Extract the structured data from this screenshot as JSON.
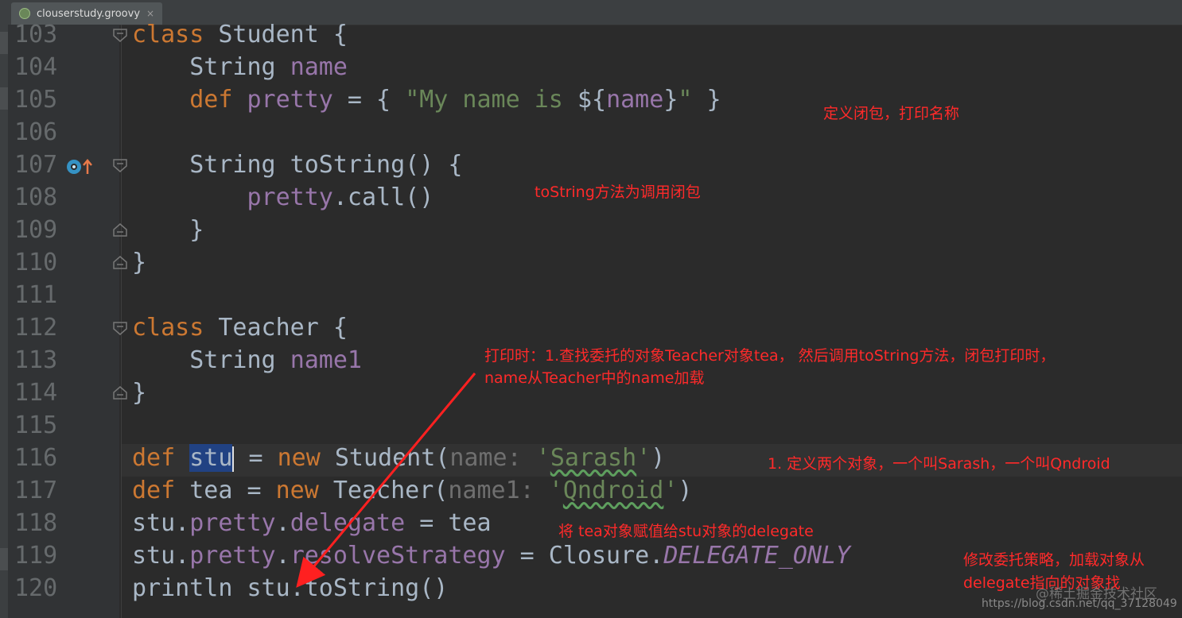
{
  "tab": {
    "filename": "clouserstudy.groovy",
    "close": "×"
  },
  "lines": [
    {
      "n": "103",
      "tokens": [
        {
          "t": "class ",
          "c": "kw"
        },
        {
          "t": "Student {",
          "c": ""
        }
      ]
    },
    {
      "n": "104",
      "tokens": [
        {
          "t": "    String ",
          "c": ""
        },
        {
          "t": "name",
          "c": "fld"
        }
      ]
    },
    {
      "n": "105",
      "tokens": [
        {
          "t": "    def ",
          "c": "kw"
        },
        {
          "t": "pretty",
          "c": "fld"
        },
        {
          "t": " = { ",
          "c": ""
        },
        {
          "t": "\"My name is ",
          "c": "str"
        },
        {
          "t": "${",
          "c": ""
        },
        {
          "t": "name",
          "c": "fld"
        },
        {
          "t": "}",
          "c": ""
        },
        {
          "t": "\"",
          "c": "str"
        },
        {
          "t": " }",
          "c": ""
        }
      ]
    },
    {
      "n": "106",
      "tokens": []
    },
    {
      "n": "107",
      "tokens": [
        {
          "t": "    String toString() {",
          "c": ""
        }
      ]
    },
    {
      "n": "108",
      "tokens": [
        {
          "t": "        ",
          "c": ""
        },
        {
          "t": "pretty",
          "c": "fld"
        },
        {
          "t": ".call()",
          "c": ""
        }
      ]
    },
    {
      "n": "109",
      "tokens": [
        {
          "t": "    }",
          "c": ""
        }
      ]
    },
    {
      "n": "110",
      "tokens": [
        {
          "t": "}",
          "c": ""
        }
      ]
    },
    {
      "n": "111",
      "tokens": []
    },
    {
      "n": "112",
      "tokens": [
        {
          "t": "class ",
          "c": "kw"
        },
        {
          "t": "Teacher {",
          "c": ""
        }
      ]
    },
    {
      "n": "113",
      "tokens": [
        {
          "t": "    String ",
          "c": ""
        },
        {
          "t": "name1",
          "c": "fld"
        }
      ]
    },
    {
      "n": "114",
      "tokens": [
        {
          "t": "}",
          "c": ""
        }
      ]
    },
    {
      "n": "115",
      "tokens": []
    },
    {
      "n": "116",
      "tokens": [
        {
          "t": "def ",
          "c": "kw"
        },
        {
          "t": "stu",
          "c": "sel"
        },
        {
          "t": "",
          "c": "caret"
        },
        {
          "t": " = ",
          "c": ""
        },
        {
          "t": "new ",
          "c": "kw"
        },
        {
          "t": "Student(",
          "c": ""
        },
        {
          "t": "name: ",
          "c": "nm"
        },
        {
          "t": "'",
          "c": "str"
        },
        {
          "t": "Sarash",
          "c": "str sq"
        },
        {
          "t": "'",
          "c": "str"
        },
        {
          "t": ")",
          "c": ""
        }
      ]
    },
    {
      "n": "117",
      "tokens": [
        {
          "t": "def ",
          "c": "kw"
        },
        {
          "t": "tea = ",
          "c": ""
        },
        {
          "t": "new ",
          "c": "kw"
        },
        {
          "t": "Teacher(",
          "c": ""
        },
        {
          "t": "name1: ",
          "c": "nm"
        },
        {
          "t": "'",
          "c": "str"
        },
        {
          "t": "Qndroid",
          "c": "str sq"
        },
        {
          "t": "'",
          "c": "str"
        },
        {
          "t": ")",
          "c": ""
        }
      ]
    },
    {
      "n": "118",
      "tokens": [
        {
          "t": "stu.",
          "c": ""
        },
        {
          "t": "pretty",
          "c": "fld"
        },
        {
          "t": ".",
          "c": ""
        },
        {
          "t": "delegate",
          "c": "fld"
        },
        {
          "t": " = tea",
          "c": ""
        }
      ]
    },
    {
      "n": "119",
      "tokens": [
        {
          "t": "stu.",
          "c": ""
        },
        {
          "t": "pretty",
          "c": "fld"
        },
        {
          "t": ".",
          "c": ""
        },
        {
          "t": "resolveStrategy",
          "c": "fld"
        },
        {
          "t": " = Closure.",
          "c": ""
        },
        {
          "t": "DELEGATE_ONLY",
          "c": "ital"
        }
      ]
    },
    {
      "n": "120",
      "tokens": [
        {
          "t": "println stu.toString()",
          "c": ""
        }
      ]
    }
  ],
  "annotations": {
    "a1": "定义闭包，打印名称",
    "a2": "toString方法为调用闭包",
    "a3_line1": "打印时：1.查找委托的对象Teacher对象tea， 然后调用toString方法，闭包打印时，",
    "a3_line2": "name从Teacher中的name加载",
    "a4": "1. 定义两个对象，一个叫Sarash，一个叫Qndroid",
    "a5": "将 tea对象赋值给stu对象的delegate",
    "a6_line1": "修改委托策略，加载对象从",
    "a6_line2": "delegate指向的对象找"
  },
  "watermark": {
    "brand": "@稀土掘金技术社区",
    "url": "https://blog.csdn.net/qq_37128049"
  },
  "colors": {
    "bg": "#2b2b2b",
    "keyword": "#cc7832",
    "field": "#9876aa",
    "string": "#6a8759",
    "annotation": "#ff2a2a"
  }
}
